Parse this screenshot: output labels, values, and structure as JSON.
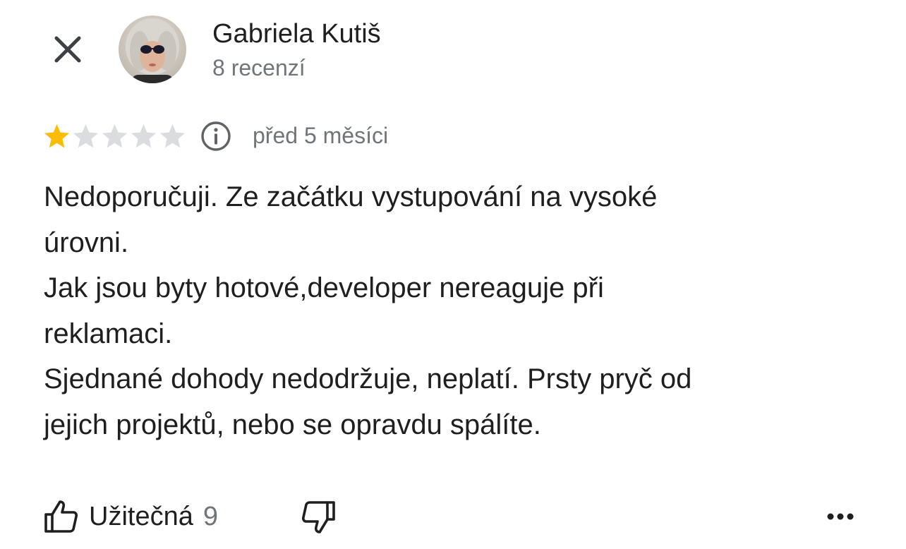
{
  "header": {
    "author_name": "Gabriela Kutiš",
    "review_count": "8 recenzí"
  },
  "review": {
    "rating": 1,
    "max_rating": 5,
    "date": "před 5 měsíci",
    "text_lines": [
      "Nedoporučuji. Ze začátku vystupování na vysoké",
      "úrovni.",
      "Jak jsou byty hotové,developer nereaguje při",
      "reklamaci.",
      "Sjednané dohody nedodržuje, neplatí. Prsty pryč od",
      "jejich projektů, nebo se opravdu spálíte."
    ]
  },
  "actions": {
    "helpful_label": "Užitečná",
    "helpful_count": "9"
  },
  "icons": {
    "close": "close-icon",
    "info": "info-icon",
    "thumbs_up": "thumbs-up-icon",
    "thumbs_down": "thumbs-down-icon",
    "more": "more-horizontal-icon"
  },
  "colors": {
    "star_filled": "#fbbc04",
    "star_empty": "#dadce0",
    "text_primary": "#1f1f1f",
    "text_secondary": "#70757a"
  }
}
